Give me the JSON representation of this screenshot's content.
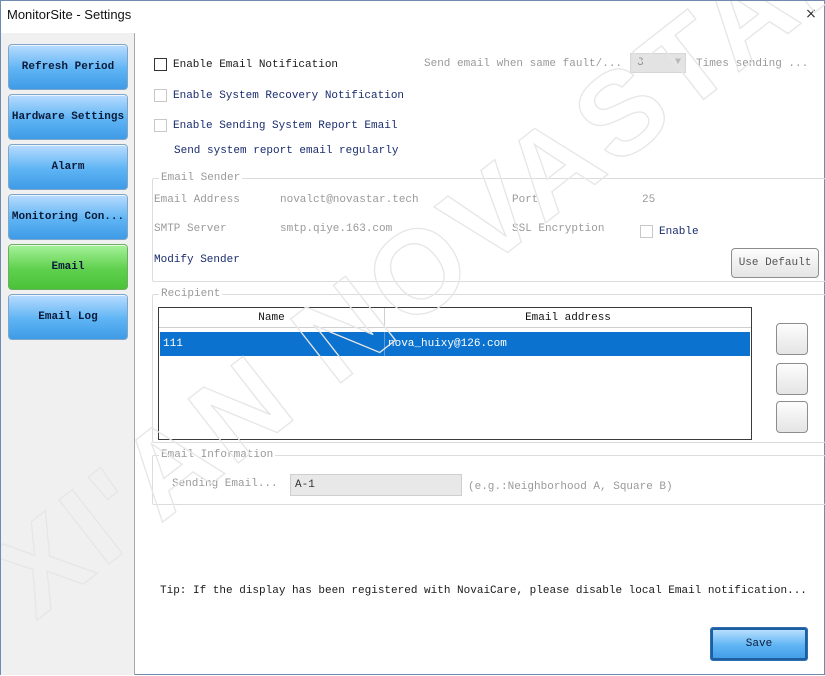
{
  "window": {
    "title": "MonitorSite - Settings",
    "close_glyph": "×"
  },
  "sidebar": {
    "items": [
      {
        "label": "Refresh Period",
        "active": false
      },
      {
        "label": "Hardware Settings",
        "active": false
      },
      {
        "label": "Alarm",
        "active": false
      },
      {
        "label": "Monitoring Con...",
        "active": false
      },
      {
        "label": "Email",
        "active": true
      },
      {
        "label": "Email Log",
        "active": false
      }
    ]
  },
  "options": {
    "enable_email_notification": "Enable Email Notification",
    "send_same_fault_label": "Send email when same fault/...",
    "times_value": "3",
    "times_label": "Times sending ...",
    "enable_system_recovery": "Enable System Recovery Notification",
    "enable_system_report": "Enable Sending System Report Email",
    "send_report_regularly": "Send system report email regularly"
  },
  "email_sender": {
    "legend": "Email Sender",
    "address_label": "Email Address",
    "address_value": "novalct@novastar.tech",
    "port_label": "Port",
    "port_value": "25",
    "smtp_label": "SMTP Server",
    "smtp_value": "smtp.qiye.163.com",
    "ssl_label": "SSL Encryption",
    "ssl_enable_label": "Enable",
    "modify_sender": "Modify Sender",
    "use_default": "Use Default"
  },
  "recipient": {
    "legend": "Recipient",
    "columns": [
      "Name",
      "Email address"
    ],
    "rows": [
      {
        "name": "111",
        "email": "nova_huixy@126.com"
      }
    ]
  },
  "email_information": {
    "legend": "Email Information",
    "sending_label": "Sending Email...",
    "sending_value": "A-1",
    "hint": "(e.g.:Neighborhood A, Square B)"
  },
  "tip": "Tip: If the display has been registered with NovaiCare, please disable local Email notification...",
  "save_label": "Save",
  "watermark": "XI'AN NOVASTAR TECH"
}
